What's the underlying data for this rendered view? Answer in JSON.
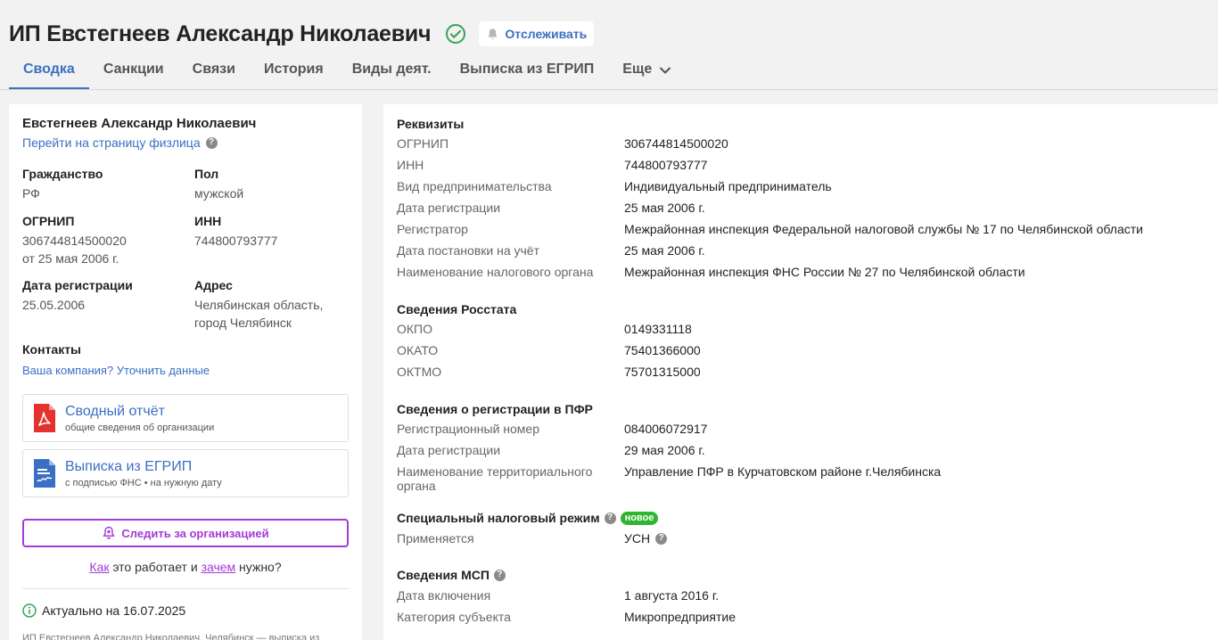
{
  "header": {
    "title": "ИП Евстегнеев Александр Николаевич",
    "track_label": "Отслеживать",
    "tabs": [
      {
        "label": "Сводка"
      },
      {
        "label": "Санкции"
      },
      {
        "label": "Связи"
      },
      {
        "label": "История"
      },
      {
        "label": "Виды деят."
      },
      {
        "label": "Выписка из ЕГРИП"
      },
      {
        "label": "Еще"
      }
    ],
    "active_tab": "Сводка"
  },
  "left": {
    "name": "Евстегнеев Александр Николаевич",
    "person_link": "Перейти на страницу физлица",
    "citizenship_label": "Гражданство",
    "citizenship_value": "РФ",
    "sex_label": "Пол",
    "sex_value": "мужской",
    "ogrnip_label": "ОГРНИП",
    "ogrnip_value": "306744814500020",
    "ogrnip_date": "от 25 мая 2006 г.",
    "inn_label": "ИНН",
    "inn_value": "744800793777",
    "regdate_label": "Дата регистрации",
    "regdate_value": "25.05.2006",
    "address_label": "Адрес",
    "address_line1": "Челябинская область,",
    "address_line2": "город Челябинск",
    "contacts_label": "Контакты",
    "contacts_link": "Ваша компания? Уточнить данные",
    "doc1_title": "Сводный отчёт",
    "doc1_sub": "общие сведения об организации",
    "doc2_title": "Выписка из ЕГРИП",
    "doc2_sub": "с подписью ФНС • на нужную дату",
    "follow_label": "Следить за организацией",
    "howto_link1": "Как",
    "howto_mid": " это работает и ",
    "howto_link2": "зачем",
    "howto_end": " нужно?",
    "actual": "Актуально на 16.07.2025",
    "footnote": "ИП Евстегнеев Александр Николаевич, Челябинск — выписка из"
  },
  "right": {
    "requisites_title": "Реквизиты",
    "requisites": [
      {
        "k": "ОГРНИП",
        "v": "306744814500020"
      },
      {
        "k": "ИНН",
        "v": "744800793777"
      },
      {
        "k": "Вид предпринимательства",
        "v": "Индивидуальный предприниматель"
      },
      {
        "k": "Дата регистрации",
        "v": "25 мая 2006 г."
      },
      {
        "k": "Регистратор",
        "v": "Межрайонная инспекция Федеральной налоговой службы № 17 по Челябинской области"
      },
      {
        "k": "Дата постановки на учёт",
        "v": "25 мая 2006 г."
      },
      {
        "k": "Наименование налогового органа",
        "v": "Межрайонная инспекция ФНС России № 27 по Челябинской области"
      }
    ],
    "rosstat_title": "Сведения Росстата",
    "rosstat": [
      {
        "k": "ОКПО",
        "v": "0149331118"
      },
      {
        "k": "ОКАТО",
        "v": "75401366000"
      },
      {
        "k": "ОКТМО",
        "v": "75701315000"
      }
    ],
    "pfr_title": "Сведения о регистрации в ПФР",
    "pfr": [
      {
        "k": "Регистрационный номер",
        "v": "084006072917"
      },
      {
        "k": "Дата регистрации",
        "v": "29 мая 2006 г."
      },
      {
        "k": "Наименование территориального органа",
        "v": "Управление ПФР в Курчатовском районе г.Челябинска"
      }
    ],
    "tax_title": "Специальный налоговый режим",
    "tax_badge": "новое",
    "tax": [
      {
        "k": "Применяется",
        "v": "УСН"
      }
    ],
    "msp_title": "Сведения МСП",
    "msp": [
      {
        "k": "Дата включения",
        "v": "1 августа 2016 г."
      },
      {
        "k": "Категория субъекта",
        "v": "Микропредприятие"
      }
    ]
  },
  "colors": {
    "accent_blue": "#3a6fc4",
    "accent_purple": "#a23bd6",
    "verified_green": "#3aa35a",
    "badge_green": "#2fb52f"
  }
}
